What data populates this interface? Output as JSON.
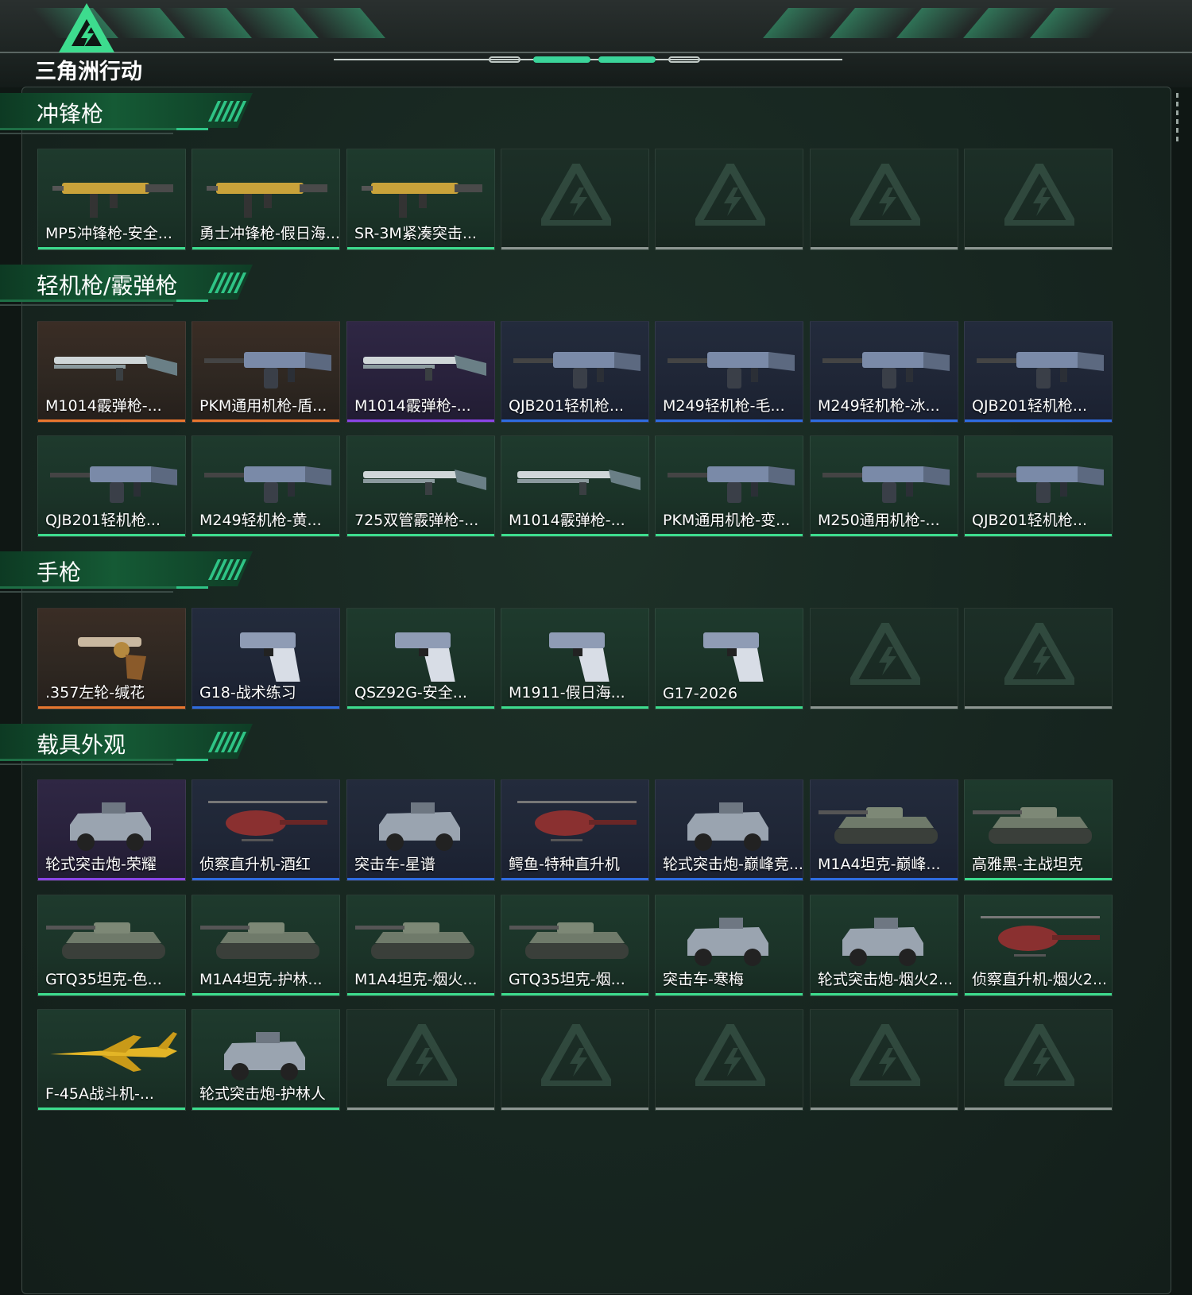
{
  "app": {
    "logo_text": "三角洲行动"
  },
  "colors": {
    "accent": "#3ddc8e",
    "orange": "#e8762f",
    "purple": "#8a45e6",
    "blue": "#2f6ce0",
    "green": "#3ddc8e",
    "empty": "#8d9692"
  },
  "sections": [
    {
      "title": "冲锋枪",
      "rows": [
        [
          {
            "name": "MP5冲锋枪-安全...",
            "rarity": "green",
            "icon": "smg-icon"
          },
          {
            "name": "勇士冲锋枪-假日海...",
            "rarity": "green",
            "icon": "smg-icon"
          },
          {
            "name": "SR-3M紧凑突击...",
            "rarity": "green",
            "icon": "smg-icon"
          },
          null,
          null,
          null,
          null
        ]
      ]
    },
    {
      "title": "轻机枪/霰弹枪",
      "rows": [
        [
          {
            "name": "M1014霰弹枪-...",
            "rarity": "orange",
            "icon": "shotgun-icon"
          },
          {
            "name": "PKM通用机枪-盾...",
            "rarity": "orange",
            "icon": "machine-gun-icon"
          },
          {
            "name": "M1014霰弹枪-...",
            "rarity": "purple",
            "icon": "shotgun-icon"
          },
          {
            "name": "QJB201轻机枪...",
            "rarity": "blue",
            "icon": "machine-gun-icon"
          },
          {
            "name": "M249轻机枪-毛...",
            "rarity": "blue",
            "icon": "machine-gun-icon"
          },
          {
            "name": "M249轻机枪-冰...",
            "rarity": "blue",
            "icon": "machine-gun-icon"
          },
          {
            "name": "QJB201轻机枪...",
            "rarity": "blue",
            "icon": "machine-gun-icon"
          }
        ],
        [
          {
            "name": "QJB201轻机枪...",
            "rarity": "green",
            "icon": "machine-gun-icon"
          },
          {
            "name": "M249轻机枪-黄...",
            "rarity": "green",
            "icon": "machine-gun-icon"
          },
          {
            "name": "725双管霰弹枪-...",
            "rarity": "green",
            "icon": "shotgun-icon"
          },
          {
            "name": "M1014霰弹枪-...",
            "rarity": "green",
            "icon": "shotgun-icon"
          },
          {
            "name": "PKM通用机枪-变...",
            "rarity": "green",
            "icon": "machine-gun-icon"
          },
          {
            "name": "M250通用机枪-...",
            "rarity": "green",
            "icon": "machine-gun-icon"
          },
          {
            "name": "QJB201轻机枪...",
            "rarity": "green",
            "icon": "machine-gun-icon"
          }
        ]
      ]
    },
    {
      "title": "手枪",
      "rows": [
        [
          {
            "name": ".357左轮-缄花",
            "rarity": "orange",
            "icon": "revolver-icon"
          },
          {
            "name": "G18-战术练习",
            "rarity": "blue",
            "icon": "pistol-icon"
          },
          {
            "name": "QSZ92G-安全...",
            "rarity": "green",
            "icon": "pistol-icon"
          },
          {
            "name": "M1911-假日海...",
            "rarity": "green",
            "icon": "pistol-icon"
          },
          {
            "name": "G17-2026",
            "rarity": "green",
            "icon": "pistol-icon"
          },
          null,
          null
        ]
      ]
    },
    {
      "title": "载具外观",
      "rows": [
        [
          {
            "name": "轮式突击炮-荣耀",
            "rarity": "purple",
            "icon": "armored-car-icon"
          },
          {
            "name": "侦察直升机-酒红",
            "rarity": "blue",
            "icon": "helicopter-icon"
          },
          {
            "name": "突击车-星谱",
            "rarity": "blue",
            "icon": "armored-car-icon"
          },
          {
            "name": "鳄鱼-特种直升机",
            "rarity": "blue",
            "icon": "helicopter-icon"
          },
          {
            "name": "轮式突击炮-巅峰竞...",
            "rarity": "blue",
            "icon": "armored-car-icon"
          },
          {
            "name": "M1A4坦克-巅峰...",
            "rarity": "blue",
            "icon": "tank-icon"
          },
          {
            "name": "高雅黑-主战坦克",
            "rarity": "green",
            "icon": "tank-icon"
          }
        ],
        [
          {
            "name": "GTQ35坦克-色...",
            "rarity": "green",
            "icon": "tank-icon"
          },
          {
            "name": "M1A4坦克-护林...",
            "rarity": "green",
            "icon": "tank-icon"
          },
          {
            "name": "M1A4坦克-烟火...",
            "rarity": "green",
            "icon": "tank-icon"
          },
          {
            "name": "GTQ35坦克-烟...",
            "rarity": "green",
            "icon": "tank-icon"
          },
          {
            "name": "突击车-寒梅",
            "rarity": "green",
            "icon": "armored-car-icon"
          },
          {
            "name": "轮式突击炮-烟火2...",
            "rarity": "green",
            "icon": "armored-car-icon"
          },
          {
            "name": "侦察直升机-烟火2...",
            "rarity": "green",
            "icon": "helicopter-icon"
          }
        ],
        [
          {
            "name": "F-45A战斗机-...",
            "rarity": "green",
            "icon": "fighter-jet-icon"
          },
          {
            "name": "轮式突击炮-护林人",
            "rarity": "green",
            "icon": "armored-car-icon"
          },
          null,
          null,
          null,
          null,
          null
        ]
      ]
    }
  ]
}
